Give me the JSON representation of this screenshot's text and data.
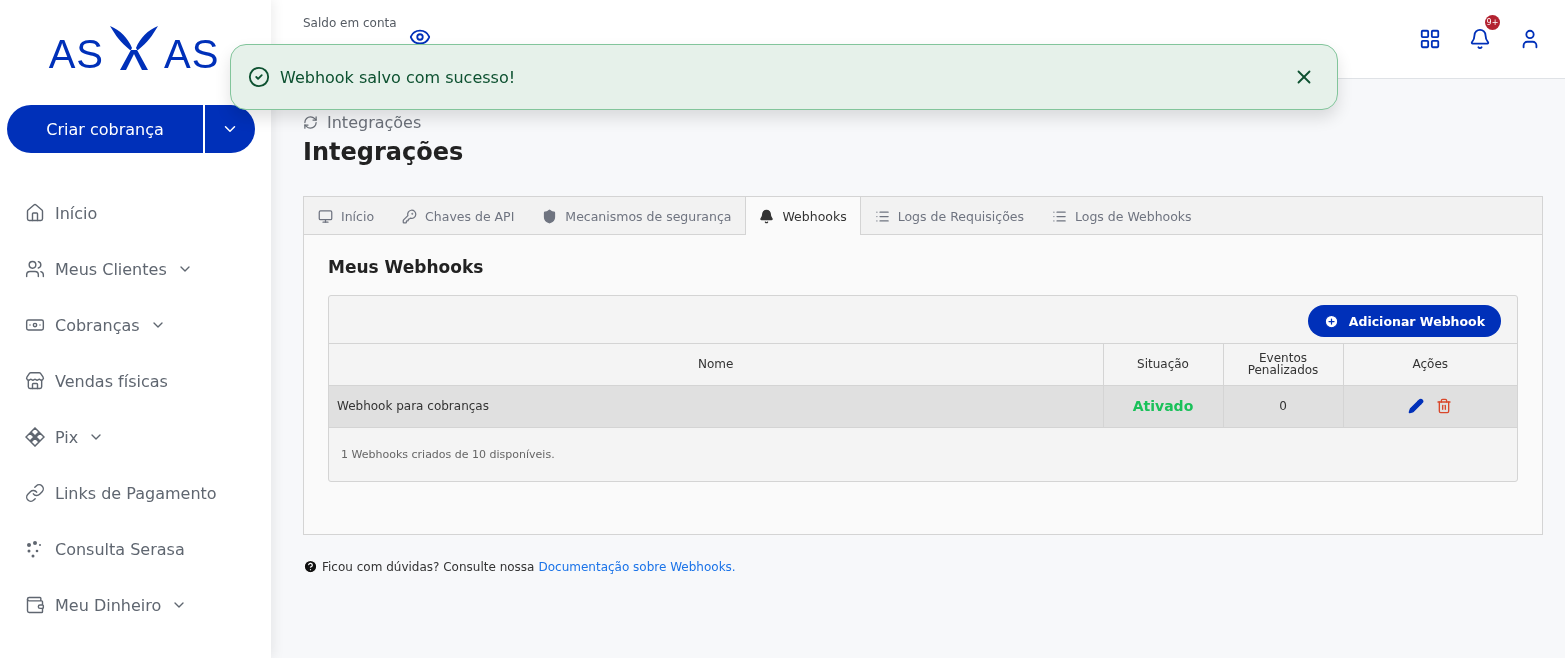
{
  "logo": {
    "left": "AS",
    "right": "AS"
  },
  "create_button": {
    "label": "Criar cobrança"
  },
  "sidebar": {
    "items": [
      {
        "label": "Início",
        "expandable": false
      },
      {
        "label": "Meus Clientes",
        "expandable": true
      },
      {
        "label": "Cobranças",
        "expandable": true
      },
      {
        "label": "Vendas físicas",
        "expandable": false
      },
      {
        "label": "Pix",
        "expandable": true
      },
      {
        "label": "Links de Pagamento",
        "expandable": false
      },
      {
        "label": "Consulta Serasa",
        "expandable": false
      },
      {
        "label": "Meu Dinheiro",
        "expandable": true
      }
    ]
  },
  "header": {
    "balance_label": "Saldo em conta",
    "notification_badge": "9+"
  },
  "toast": {
    "message": "Webhook salvo com sucesso!"
  },
  "breadcrumb": "Integrações",
  "page_title": "Integrações",
  "tabs": [
    {
      "label": "Início",
      "selected": false
    },
    {
      "label": "Chaves de API",
      "selected": false
    },
    {
      "label": "Mecanismos de segurança",
      "selected": false
    },
    {
      "label": "Webhooks",
      "selected": true
    },
    {
      "label": "Logs de Requisições",
      "selected": false
    },
    {
      "label": "Logs de Webhooks",
      "selected": false
    }
  ],
  "section_title": "Meus Webhooks",
  "add_button": "Adicionar Webhook",
  "table": {
    "columns": [
      "Nome",
      "Situação",
      "Eventos Penalizados",
      "Ações"
    ],
    "rows": [
      {
        "name": "Webhook para cobranças",
        "status": "Ativado",
        "active": true,
        "penalized": "0"
      }
    ],
    "footer": "1 Webhooks criados de 10 disponíveis."
  },
  "help": {
    "text": "Ficou com dúvidas? Consulte nossa",
    "link": "Documentação sobre Webhooks."
  }
}
